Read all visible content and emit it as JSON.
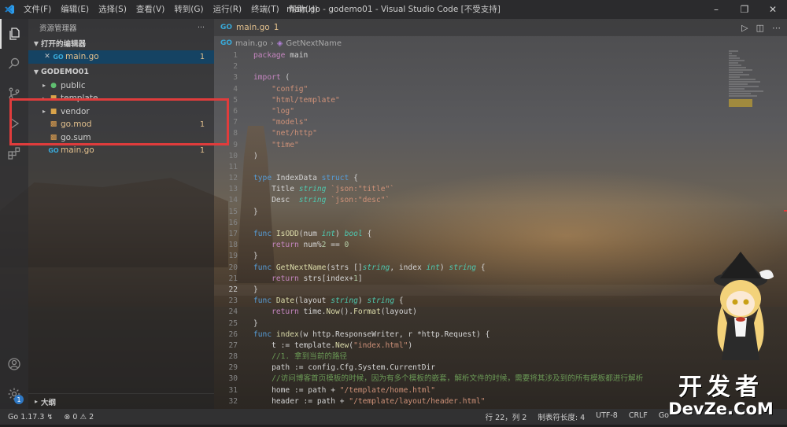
{
  "titlebar": {
    "menus": [
      "文件(F)",
      "编辑(E)",
      "选择(S)",
      "查看(V)",
      "转到(G)",
      "运行(R)",
      "终端(T)",
      "帮助(H)"
    ],
    "window_title": "main.go - godemo01 - Visual Studio Code [不受支持]"
  },
  "sidebar": {
    "header": "资源管理器",
    "more": "···",
    "open_editors_label": "打开的编辑器",
    "open_editor": {
      "name": "main.go",
      "count": "1"
    },
    "project_label": "GODEMO01",
    "tree": [
      {
        "name": "public",
        "type": "folder"
      },
      {
        "name": "template",
        "type": "folder"
      },
      {
        "name": "vendor",
        "type": "folder"
      },
      {
        "name": "go.mod",
        "type": "mod",
        "count": "1"
      },
      {
        "name": "go.sum",
        "type": "sum"
      },
      {
        "name": "main.go",
        "type": "go",
        "count": "1"
      }
    ],
    "outline_label": "大纲"
  },
  "editor": {
    "tab": {
      "name": "main.go",
      "count": "1"
    },
    "breadcrumb": {
      "file": "main.go",
      "symbol": "GetNextName"
    }
  },
  "code_lines": [
    "package main",
    "",
    "import (",
    "    \"config\"",
    "    \"html/template\"",
    "    \"log\"",
    "    \"models\"",
    "    \"net/http\"",
    "    \"time\"",
    ")",
    "",
    "type IndexData struct {",
    "    Title string `json:\"title\"`",
    "    Desc  string `json:\"desc\"`",
    "}",
    "",
    "func IsODD(num int) bool {",
    "    return num%2 == 0",
    "}",
    "func GetNextName(strs []string, index int) string {",
    "    return strs[index+1]",
    "}",
    "func Date(layout string) string {",
    "    return time.Now().Format(layout)",
    "}",
    "func index(w http.ResponseWriter, r *http.Request) {",
    "    t := template.New(\"index.html\")",
    "    //1. 拿到当前的路径",
    "    path := config.Cfg.System.CurrentDir",
    "    //访问博客首页模板的时候，因为有多个模板的嵌套，解析文件的时候，需要将其涉及到的所有模板都进行解析",
    "    home := path + \"/template/home.html\"",
    "    header := path + \"/template/layout/header.html\""
  ],
  "statusbar": {
    "go_version": "Go 1.17.3",
    "errors": "0",
    "warnings": "2",
    "cursor": "行 22，列 2",
    "tab_size": "制表符长度: 4",
    "encoding": "UTF-8",
    "eol": "CRLF",
    "language": "Go"
  },
  "watermark": {
    "top": "开发者",
    "bottom": "DevZe.CoM"
  },
  "colors": {
    "accent_blue": "#2c9bea",
    "modified_yellow": "#e2c08d",
    "highlight_box": "#e03c3c"
  }
}
